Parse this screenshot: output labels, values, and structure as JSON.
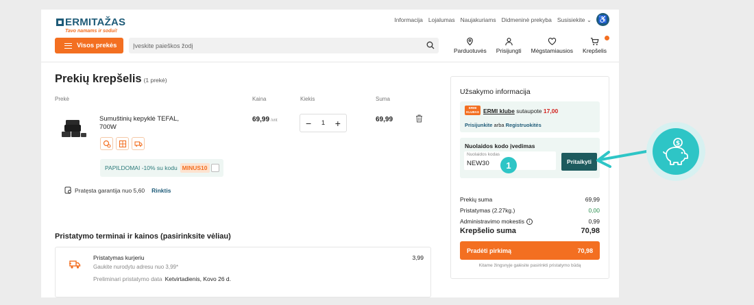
{
  "brand": {
    "name": "ERMITAŽAS",
    "tagline": "Tavo namams ir sodui!"
  },
  "top_links": [
    "Informacija",
    "Lojalumas",
    "Naujakuriams",
    "Didmeninė prekyba",
    "Susisiekite"
  ],
  "header": {
    "menu_label": "Visos prekės",
    "search_placeholder": "Įveskite paieškos žodį",
    "nav": [
      "Parduotuvės",
      "Prisijungti",
      "Mėgstamiausios",
      "Krepšelis"
    ]
  },
  "cart": {
    "title": "Prekių krepšelis",
    "count": "(1 prekė)",
    "columns": {
      "product": "Prekė",
      "price": "Kaina",
      "qty": "Kiekis",
      "sum": "Suma"
    },
    "item": {
      "name": "Sumuštinių kepyklė TEFAL, 700W",
      "price": "69,99",
      "unit": "/vnt",
      "qty": "1",
      "sum": "69,99",
      "promo_text": "PAPILDOMAI -10% su kodu",
      "promo_code": "MINUS10"
    },
    "warranty": {
      "text": "Pratęsta garantija nuo 5,60",
      "link": "Rinktis"
    }
  },
  "delivery": {
    "title": "Pristatymo terminai ir kainos (pasirinksite vėliau)",
    "option_title": "Pristatymas kurjeriu",
    "option_sub": "Gaukite nurodytu adresu nuo 3,99*",
    "date_label": "Preliminari pristatymo data",
    "date_value": "Ketvirtadienis, Kovo 26 d.",
    "price": "3,99"
  },
  "summary": {
    "title": "Užsakymo informacija",
    "ermi_logo_1": "ERMI",
    "ermi_logo_2": "KLUBAS",
    "ermi_link": "ERMI klube",
    "ermi_saved": "sutaupote",
    "ermi_amount": "17,00",
    "join": "Prisijunkite",
    "or": "arba",
    "register": "Registruokitės",
    "coupon_title": "Nuolaidos kodo įvedimas",
    "coupon_label": "Nuolaidos kodas",
    "coupon_value": "NEW30",
    "apply": "Pritaikyti",
    "step": "1",
    "rows": [
      {
        "label": "Prekių suma",
        "value": "69,99"
      },
      {
        "label": "Pristatymas (2.27kg.)",
        "value": "0,00"
      },
      {
        "label": "Administravimo mokestis",
        "value": "0,99"
      }
    ],
    "total_label": "Krepšelio suma",
    "total_value": "70,98",
    "checkout_label": "Pradėti pirkimą",
    "checkout_value": "70,98",
    "note": "Kitame žingsnyje galėsite pasirinkti pristatymo būdą"
  }
}
